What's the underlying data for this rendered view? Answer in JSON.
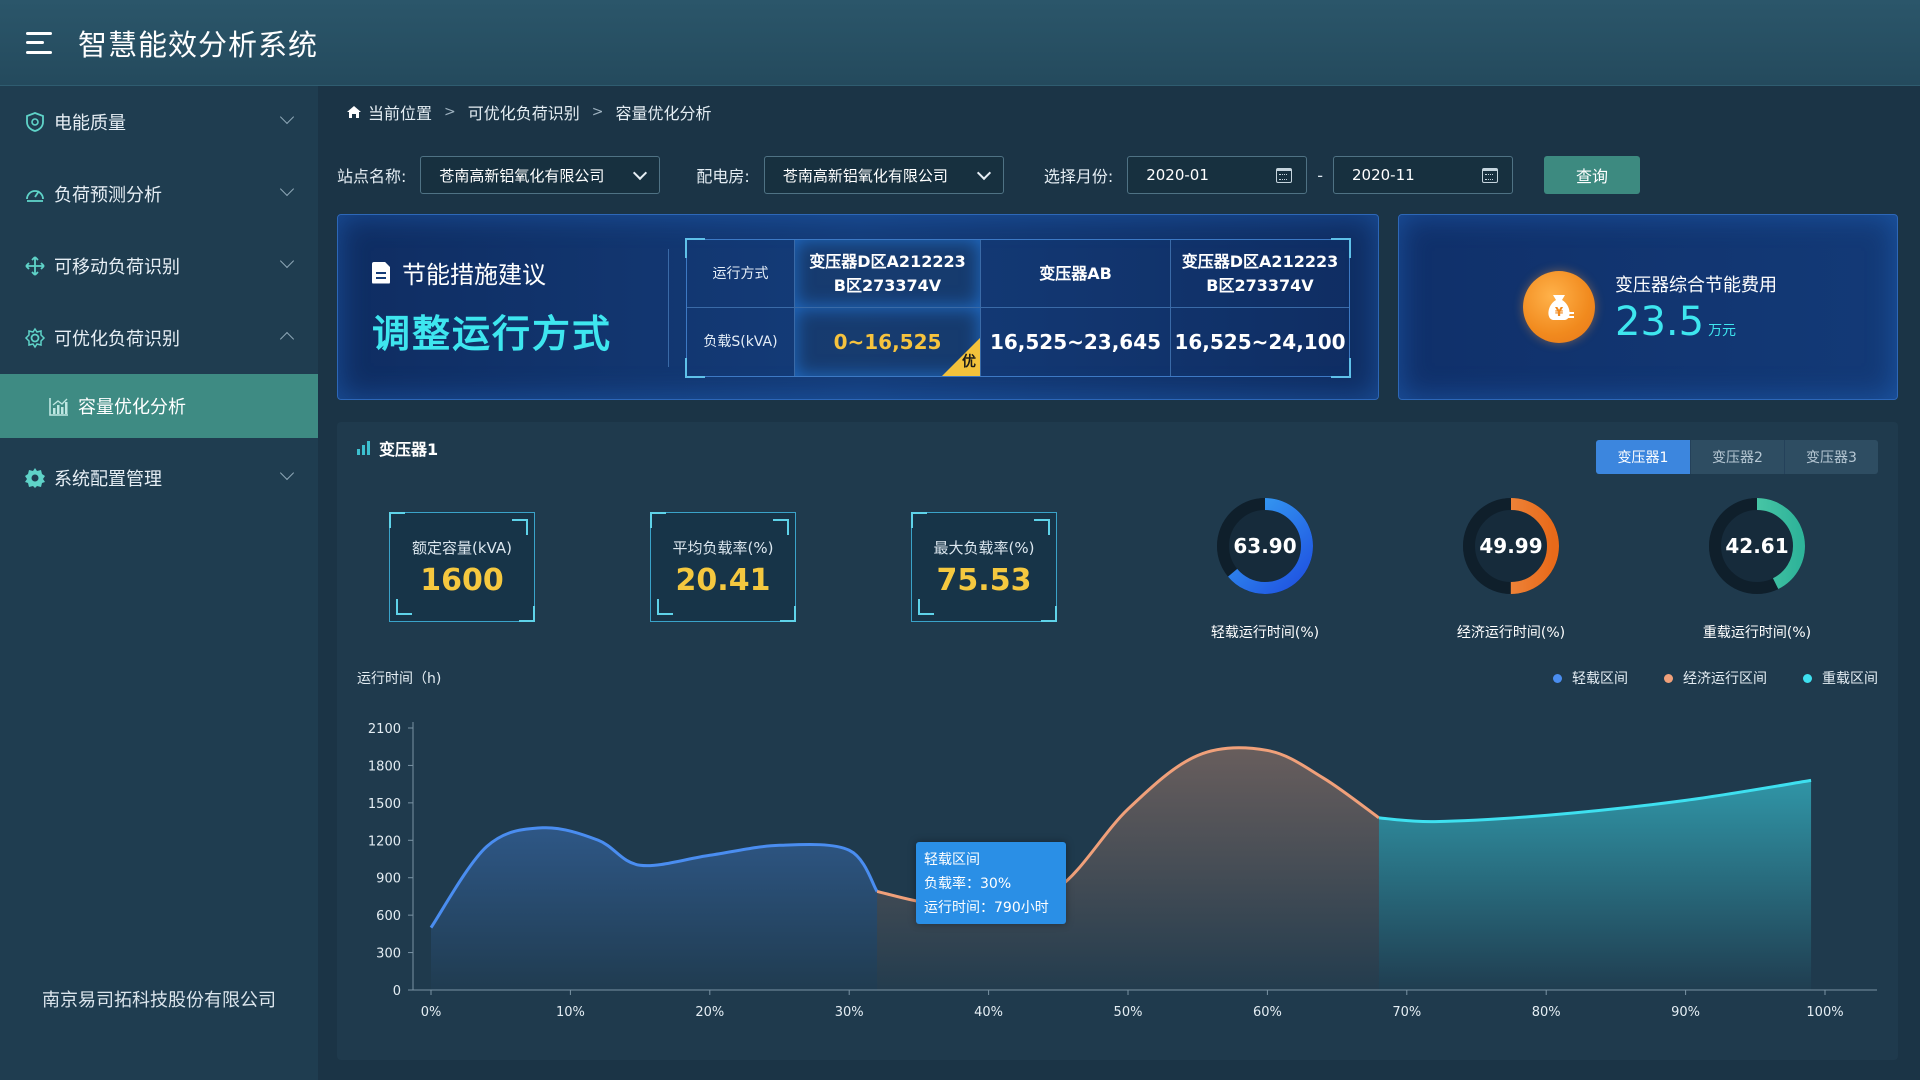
{
  "header": {
    "title": "智慧能效分析系统"
  },
  "sidebar": {
    "items": [
      {
        "label": "电能质量",
        "icon": "shield-icon"
      },
      {
        "label": "负荷预测分析",
        "icon": "gauge-icon"
      },
      {
        "label": "可移动负荷识别",
        "icon": "move-icon"
      },
      {
        "label": "可优化负荷识别",
        "icon": "gear-icon",
        "expanded": true,
        "children": [
          {
            "label": "容量优化分析",
            "icon": "chart-icon",
            "active": true
          }
        ]
      },
      {
        "label": "系统配置管理",
        "icon": "settings-icon"
      }
    ],
    "company": "南京易司拓科技股份有限公司"
  },
  "breadcrumb": {
    "items": [
      "当前位置",
      "可优化负荷识别",
      "容量优化分析"
    ]
  },
  "filters": {
    "station_label": "站点名称:",
    "station_value": "苍南高新铝氧化有限公司",
    "room_label": "配电房:",
    "room_value": "苍南高新铝氧化有限公司",
    "month_label": "选择月份:",
    "month_start": "2020-01",
    "month_sep": "-",
    "month_end": "2020-11",
    "query_label": "查询"
  },
  "advice": {
    "heading": "节能措施建议",
    "main": "调整运行方式",
    "table": {
      "row_head_mode": "运行方式",
      "row_head_load": "负载S(kVA)",
      "columns": [
        {
          "name_l1": "变压器D区A212223",
          "name_l2": "B区273374V",
          "load": "0~16,525",
          "badge": "优"
        },
        {
          "name_l1": "变压器AB",
          "name_l2": "",
          "load": "16,525~23,645"
        },
        {
          "name_l1": "变压器D区A212223",
          "name_l2": "B区273374V",
          "load": "16,525~24,100"
        }
      ]
    }
  },
  "cost": {
    "label": "变压器综合节能费用",
    "value": "23.5",
    "unit": "万元"
  },
  "panel": {
    "title": "变压器1",
    "tabs": [
      "变压器1",
      "变压器2",
      "变压器3"
    ],
    "active_tab": 0,
    "stats": [
      {
        "label": "额定容量(kVA)",
        "value": "1600"
      },
      {
        "label": "平均负载率(%)",
        "value": "20.41"
      },
      {
        "label": "最大负载率(%)",
        "value": "75.53"
      }
    ],
    "donuts": [
      {
        "value": "63.90",
        "label": "轻载运行时间(%)",
        "percent": 63.9,
        "color_start": "#1e4fe0",
        "color_end": "#39a8f5"
      },
      {
        "value": "49.99",
        "label": "经济运行时间(%)",
        "percent": 49.99,
        "color_start": "#f07a24",
        "color_end": "#f39a55"
      },
      {
        "value": "42.61",
        "label": "重载运行时间(%)",
        "percent": 42.61,
        "color_start": "#2fb49a",
        "color_end": "#5fd6b0"
      }
    ]
  },
  "chart_data": {
    "type": "area",
    "ylabel": "运行时间（h)",
    "ylim": [
      0,
      2100
    ],
    "yticks": [
      0,
      300,
      600,
      900,
      1200,
      1500,
      1800,
      2100
    ],
    "xticks": [
      "0%",
      "10%",
      "20%",
      "30%",
      "40%",
      "50%",
      "60%",
      "70%",
      "80%",
      "90%",
      "100%"
    ],
    "xlim": [
      0,
      100
    ],
    "series": [
      {
        "name": "轻载区间",
        "color": "#4a8df0",
        "x": [
          0,
          4,
          8,
          12,
          15,
          20,
          25,
          30,
          32
        ],
        "y": [
          500,
          1150,
          1300,
          1200,
          1000,
          1080,
          1160,
          1120,
          790
        ]
      },
      {
        "name": "经济运行区间",
        "color": "#f0a07a",
        "x": [
          32,
          36,
          40,
          45,
          50,
          55,
          60,
          64,
          68
        ],
        "y": [
          790,
          690,
          680,
          820,
          1450,
          1880,
          1920,
          1700,
          1380
        ]
      },
      {
        "name": "重载区间",
        "color": "#3ee0f0",
        "x": [
          68,
          72,
          80,
          90,
          99
        ],
        "y": [
          1380,
          1350,
          1400,
          1520,
          1680
        ]
      }
    ],
    "tooltip": {
      "title": "轻载区间",
      "line1": "负载率：30%",
      "line2": "运行时间：790小时"
    }
  }
}
